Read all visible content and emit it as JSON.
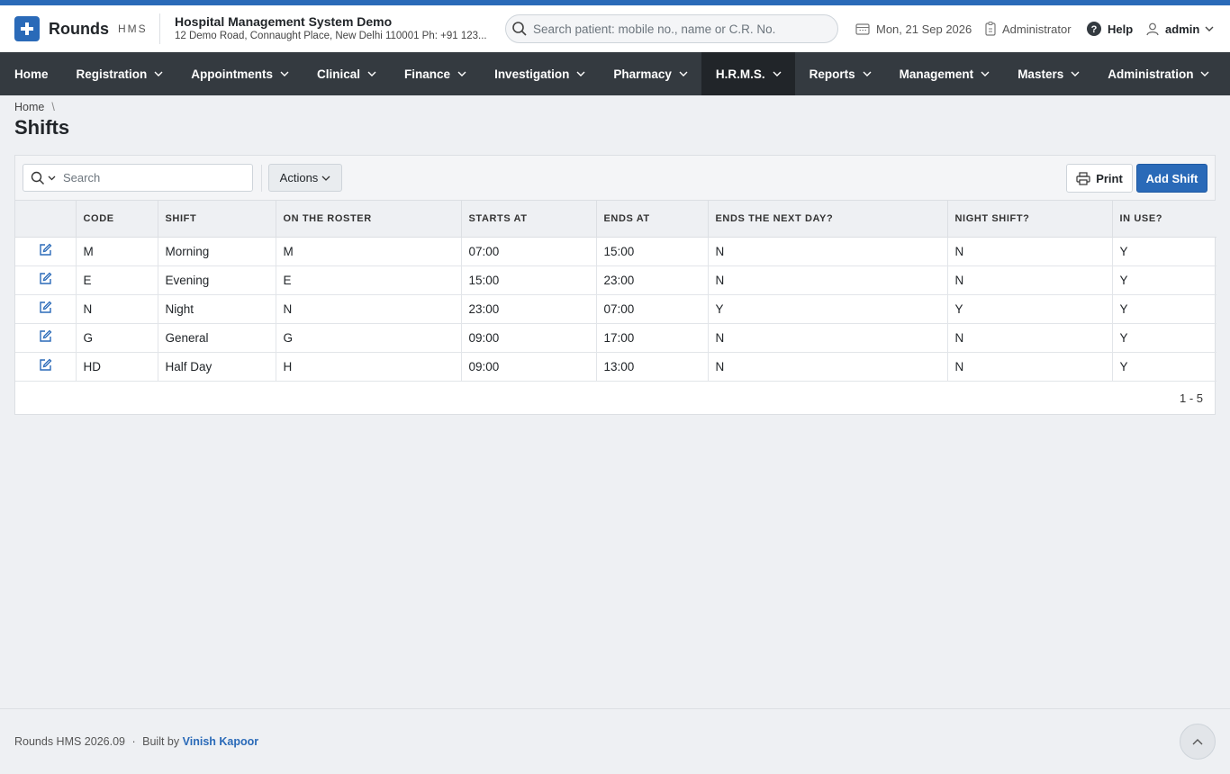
{
  "brand": {
    "name": "Rounds",
    "sub": "HMS"
  },
  "hospital": {
    "name": "Hospital Management System Demo",
    "address": "12 Demo Road, Connaught Place, New Delhi 110001 Ph: +91 123..."
  },
  "search": {
    "placeholder": "Search patient: mobile no., name or C.R. No."
  },
  "header": {
    "date": "Mon, 21 Sep 2026",
    "role": "Administrator",
    "help": "Help",
    "user": "admin"
  },
  "nav": [
    {
      "label": "Home",
      "dropdown": false
    },
    {
      "label": "Registration",
      "dropdown": true
    },
    {
      "label": "Appointments",
      "dropdown": true
    },
    {
      "label": "Clinical",
      "dropdown": true
    },
    {
      "label": "Finance",
      "dropdown": true
    },
    {
      "label": "Investigation",
      "dropdown": true
    },
    {
      "label": "Pharmacy",
      "dropdown": true
    },
    {
      "label": "H.R.M.S.",
      "dropdown": true,
      "active": true
    },
    {
      "label": "Reports",
      "dropdown": true
    },
    {
      "label": "Management",
      "dropdown": true
    },
    {
      "label": "Masters",
      "dropdown": true
    },
    {
      "label": "Administration",
      "dropdown": true
    }
  ],
  "breadcrumb": {
    "home": "Home",
    "separator": "\\"
  },
  "page": {
    "title": "Shifts"
  },
  "toolbar": {
    "search_placeholder": "Search",
    "actions_label": "Actions",
    "print_label": "Print",
    "add_label": "Add Shift"
  },
  "table": {
    "columns": [
      "CODE",
      "SHIFT",
      "ON THE ROSTER",
      "STARTS AT",
      "ENDS AT",
      "ENDS THE NEXT DAY?",
      "NIGHT SHIFT?",
      "IN USE?"
    ],
    "rows": [
      [
        "M",
        "Morning",
        "M",
        "07:00",
        "15:00",
        "N",
        "N",
        "Y"
      ],
      [
        "E",
        "Evening",
        "E",
        "15:00",
        "23:00",
        "N",
        "N",
        "Y"
      ],
      [
        "N",
        "Night",
        "N",
        "23:00",
        "07:00",
        "Y",
        "Y",
        "Y"
      ],
      [
        "G",
        "General",
        "G",
        "09:00",
        "17:00",
        "N",
        "N",
        "Y"
      ],
      [
        "HD",
        "Half Day",
        "H",
        "09:00",
        "13:00",
        "N",
        "N",
        "Y"
      ]
    ]
  },
  "pagination": {
    "range": "1 - 5"
  },
  "footer": {
    "version": "Rounds HMS 2026.09",
    "separator": "·",
    "built_by": "Built by",
    "author": "Vinish Kapoor"
  },
  "colors": {
    "accent": "#2a6ab8",
    "navbar": "#343a40",
    "nav_active": "#212529"
  }
}
